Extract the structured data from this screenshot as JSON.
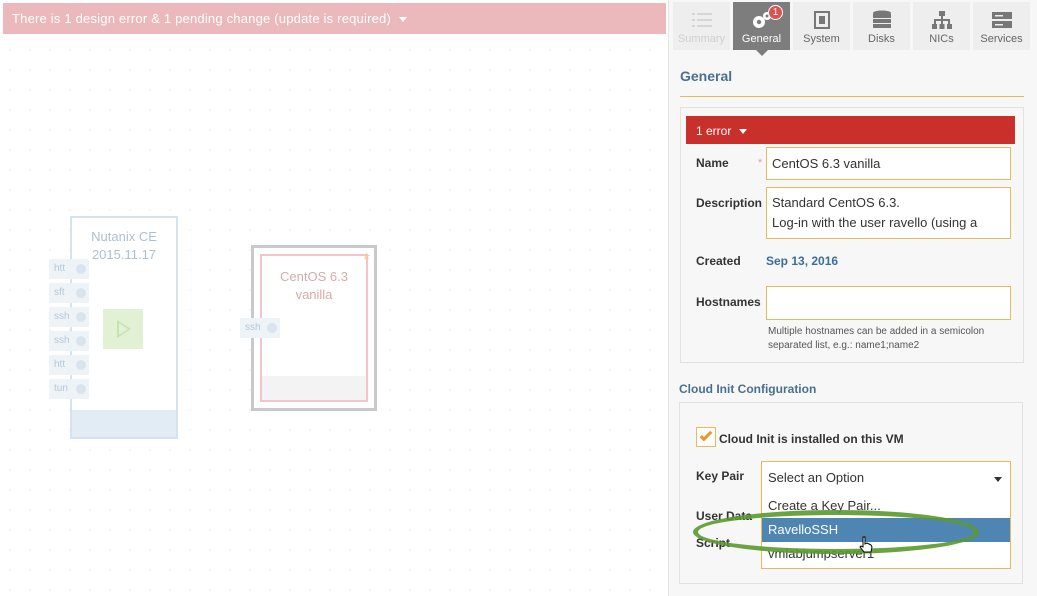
{
  "banner": {
    "text": "There is 1 design error & 1 pending change (update is required)"
  },
  "canvas": {
    "vm1": {
      "name_line1": "Nutanix CE",
      "name_line2": "2015.11.17",
      "ports": [
        "htt",
        "sft",
        "ssh",
        "ssh",
        "htt",
        "tun"
      ]
    },
    "vm2": {
      "name_line1": "CentOS 6.3",
      "name_line2": "vanilla",
      "ports": [
        "ssh"
      ],
      "star": "*"
    }
  },
  "tabs": [
    {
      "label": "Summary",
      "icon": "list-icon"
    },
    {
      "label": "General",
      "icon": "gears-icon",
      "badge": "1"
    },
    {
      "label": "System",
      "icon": "cpu-icon"
    },
    {
      "label": "Disks",
      "icon": "database-icon"
    },
    {
      "label": "NICs",
      "icon": "network-icon"
    },
    {
      "label": "Services",
      "icon": "server-icon"
    }
  ],
  "general": {
    "title": "General",
    "error_label": "1 error",
    "name_label": "Name",
    "required_mark": "*",
    "name_value": "CentOS 6.3 vanilla",
    "description_label": "Description",
    "description_line1": "Standard CentOS 6.3.",
    "description_line2": "Log-in with the user ravello (using a SSH",
    "created_label": "Created",
    "created_value": "Sep 13, 2016",
    "hostnames_label": "Hostnames",
    "hostnames_value": "",
    "hostnames_help": "Multiple hostnames can be added in a semicolon separated list, e.g.: name1;name2"
  },
  "cloud_init": {
    "title": "Cloud Init Configuration",
    "installed_label": "Cloud Init is installed on this VM",
    "installed_checked": true,
    "key_pair_label": "Key Pair",
    "key_pair_placeholder": "Select an Option",
    "user_data_label": "User Data",
    "script_label": "Script",
    "options": [
      "Create a Key Pair...",
      "RavelloSSH",
      "vmlabjumpserver1"
    ],
    "highlighted_option": "RavelloSSH"
  },
  "colors": {
    "accent": "#e9b95a",
    "error": "#c9302c",
    "selected": "#4f85b3",
    "title": "#4b6f8f"
  }
}
